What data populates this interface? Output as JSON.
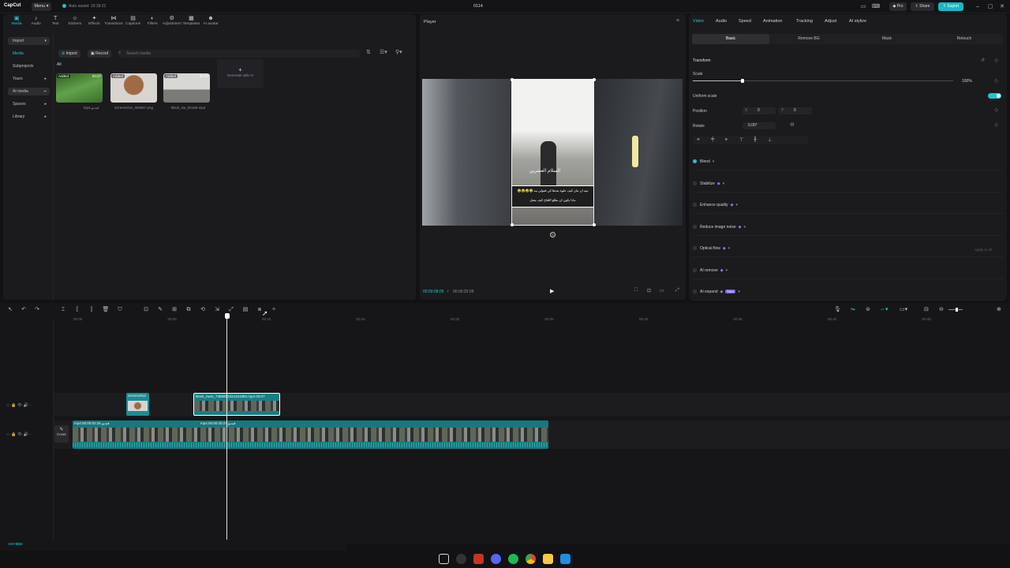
{
  "app": {
    "logo": "CapCut",
    "menu_label": "Menu",
    "autosave": "Auto saved: 10:18:21",
    "project_title": "0114"
  },
  "titlebar": {
    "pro_label": "Pro",
    "share_label": "Share",
    "export_label": "Export"
  },
  "media_tabs": [
    {
      "label": "Media",
      "icon": "media-icon"
    },
    {
      "label": "Audio",
      "icon": "audio-icon"
    },
    {
      "label": "Text",
      "icon": "text-icon"
    },
    {
      "label": "Stickers",
      "icon": "stickers-icon"
    },
    {
      "label": "Effects",
      "icon": "effects-icon"
    },
    {
      "label": "Transitions",
      "icon": "transitions-icon"
    },
    {
      "label": "Captions",
      "icon": "captions-icon"
    },
    {
      "label": "Filters",
      "icon": "filters-icon"
    },
    {
      "label": "Adjustment",
      "icon": "adjustment-icon"
    },
    {
      "label": "Templates",
      "icon": "templates-icon"
    },
    {
      "label": "AI avatar",
      "icon": "ai-avatar-icon"
    }
  ],
  "sidebar": {
    "items": [
      "Import",
      "Media",
      "Subprojects",
      "Yours",
      "AI media",
      "Spaces",
      "Library"
    ]
  },
  "media_toolbar": {
    "import_label": "Import",
    "record_label": "Record",
    "search_placeholder": "Search media",
    "filter_all": "All"
  },
  "media_items": [
    {
      "badge": "Added",
      "duration": "00:27",
      "name": "mp4.فيديو"
    },
    {
      "badge": "Added",
      "duration": "",
      "name": "Screenshot_305557.png"
    },
    {
      "badge": "Added",
      "duration": "00:07",
      "name": "tiktok_nw_92199.mp4"
    }
  ],
  "generate_label": "Generate with AI",
  "player": {
    "title": "Player",
    "current_time": "00:00:08:05",
    "total_time": "00:00:25:09",
    "overlay_caption": "السلام العشرين",
    "overlay_lines": [
      "😂😂😂😂 تبيه ان تبان كيف حلوة بعدها كي فعولي بيه",
      "ماذا يكون ان يطلع اللقاح كيف يفعل"
    ]
  },
  "props": {
    "tabs": [
      "Video",
      "Audio",
      "Speed",
      "Animation",
      "Tracking",
      "Adjust",
      "AI stylize"
    ],
    "subtabs": [
      "Basic",
      "Remove BG",
      "Mask",
      "Retouch"
    ],
    "transform_label": "Transform",
    "scale_label": "Scale",
    "scale_value": "100%",
    "scale_fraction": 0.19,
    "uniform_scale_label": "Uniform scale",
    "position_label": "Position",
    "pos_x_label": "X",
    "pos_x": "0",
    "pos_y_label": "Y",
    "pos_y": "0",
    "rotate_label": "Rotate",
    "rotate_value": "0.00°",
    "sections": [
      "Blend",
      "Stabilize",
      "Enhance quality",
      "Reduce image noise",
      "Optical flow",
      "AI remove",
      "AI expand"
    ],
    "new_badge": "New",
    "apply_all": "Apply to all"
  },
  "timeline": {
    "ticks": [
      "00:00",
      "00:05",
      "00:10",
      "00:15",
      "00:20",
      "00:25",
      "00:30",
      "00:35",
      "00:40",
      "00:45"
    ],
    "clip_screenshot": "Screenshot",
    "clip_tiktok": "tiktok_nwm_7385852324161982.mp4  00:07",
    "main_clip_label": "mp4.فيديو  00:00:02:26",
    "main_clip_label2": "mp4.فيديو  00:00:20:27",
    "cover_label": "Cover",
    "audio_label": "AMY$$M"
  }
}
